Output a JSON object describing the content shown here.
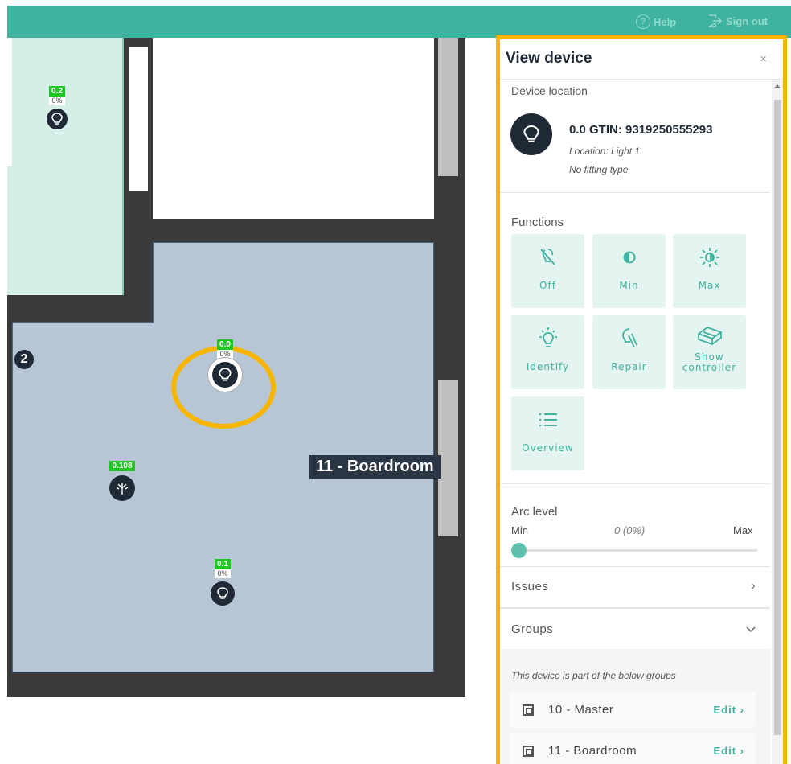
{
  "topbar": {
    "help_label": "Help",
    "signout_label": "Sign out"
  },
  "map": {
    "room_label": "11 - Boardroom",
    "area_number": "2",
    "markers": [
      {
        "address": "0.2",
        "level": "0%",
        "icon": "bulb-icon"
      },
      {
        "address": "0.0",
        "level": "0%",
        "icon": "bulb-icon"
      },
      {
        "address": "0.108",
        "icon": "sensor-icon"
      },
      {
        "address": "0.1",
        "level": "0%",
        "icon": "bulb-icon"
      }
    ]
  },
  "panel": {
    "title": "View device",
    "close_label": "×",
    "device_location_label": "Device location",
    "device": {
      "name": "0.0 GTIN: 9319250555293",
      "location": "Location: Light 1",
      "fitting": "No fitting type"
    },
    "functions_label": "Functions",
    "functions": [
      {
        "label": "Off",
        "icon": "bulb-off-icon"
      },
      {
        "label": "Min",
        "icon": "half-circle-icon"
      },
      {
        "label": "Max",
        "icon": "brightness-icon"
      },
      {
        "label": "Identify",
        "icon": "bulb-rays-icon"
      },
      {
        "label": "Repair",
        "icon": "repair-icon"
      },
      {
        "label": "Show controller",
        "icon": "controller-icon"
      },
      {
        "label": "Overview",
        "icon": "list-icon"
      }
    ],
    "arc_level": {
      "label": "Arc level",
      "min_label": "Min",
      "max_label": "Max",
      "value_text": "0 (0%)",
      "value_fraction": 0
    },
    "issues_label": "Issues",
    "groups_label": "Groups",
    "groups_note": "This device is part of the below groups",
    "groups": [
      {
        "name": "10 - Master",
        "edit_label": "Edit"
      },
      {
        "name": "11 - Boardroom",
        "edit_label": "Edit"
      }
    ],
    "accent_color": "#3fb39f",
    "highlight_color": "#f7b500"
  }
}
